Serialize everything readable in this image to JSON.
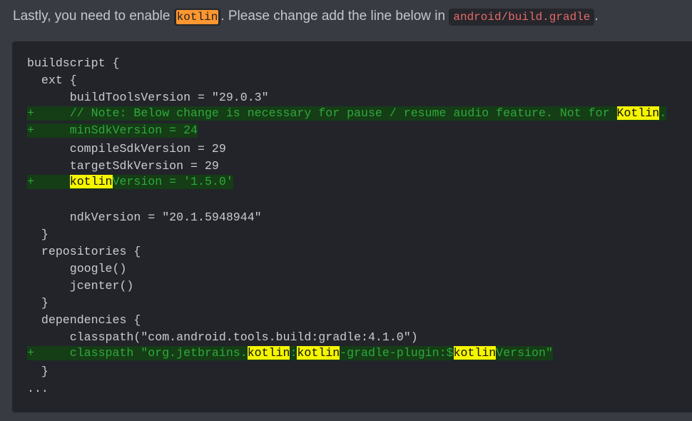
{
  "intro": {
    "text_before": "Lastly, you need to enable ",
    "keyword": "kotlin",
    "text_middle": ". Please change add the line below in ",
    "file_path": "android/build.gradle",
    "text_after": "."
  },
  "code": {
    "l1": "buildscript {",
    "l2": "  ext {",
    "l3": "      buildToolsVersion = \"29.0.3\"",
    "l4_pre": "+     // Note: Below change is necessary for pause / resume audio feature. Not for ",
    "l4_hl": "Kotlin",
    "l4_post": ".",
    "l5": "+     minSdkVersion = 24",
    "l6": "      compileSdkVersion = 29",
    "l7": "      targetSdkVersion = 29",
    "l8_pre": "+     ",
    "l8_hl": "kotlin",
    "l8_post": "Version = '1.5.0'",
    "l9": "",
    "l10": "      ndkVersion = \"20.1.5948944\"",
    "l11": "  }",
    "l12": "  repositories {",
    "l13": "      google()",
    "l14": "      jcenter()",
    "l15": "  }",
    "l16": "  dependencies {",
    "l17": "      classpath(\"com.android.tools.build:gradle:4.1.0\")",
    "l18_a": "+     classpath \"org.jetbrains.",
    "l18_hl1": "kotlin",
    "l18_b": ":",
    "l18_hl2": "kotlin",
    "l18_c": "-gradle-plugin:$",
    "l18_hl3": "kotlin",
    "l18_d": "Version\"",
    "l19": "  }",
    "l20": "..."
  },
  "colors": {
    "page_bg": "#383b42",
    "code_bg": "#22242a",
    "added_text": "#2fa83b",
    "added_bg": "#153d16",
    "highlight_yellow": "#f5f500",
    "highlight_orange": "#ff9731",
    "inline_code_text": "#e66a6a"
  }
}
